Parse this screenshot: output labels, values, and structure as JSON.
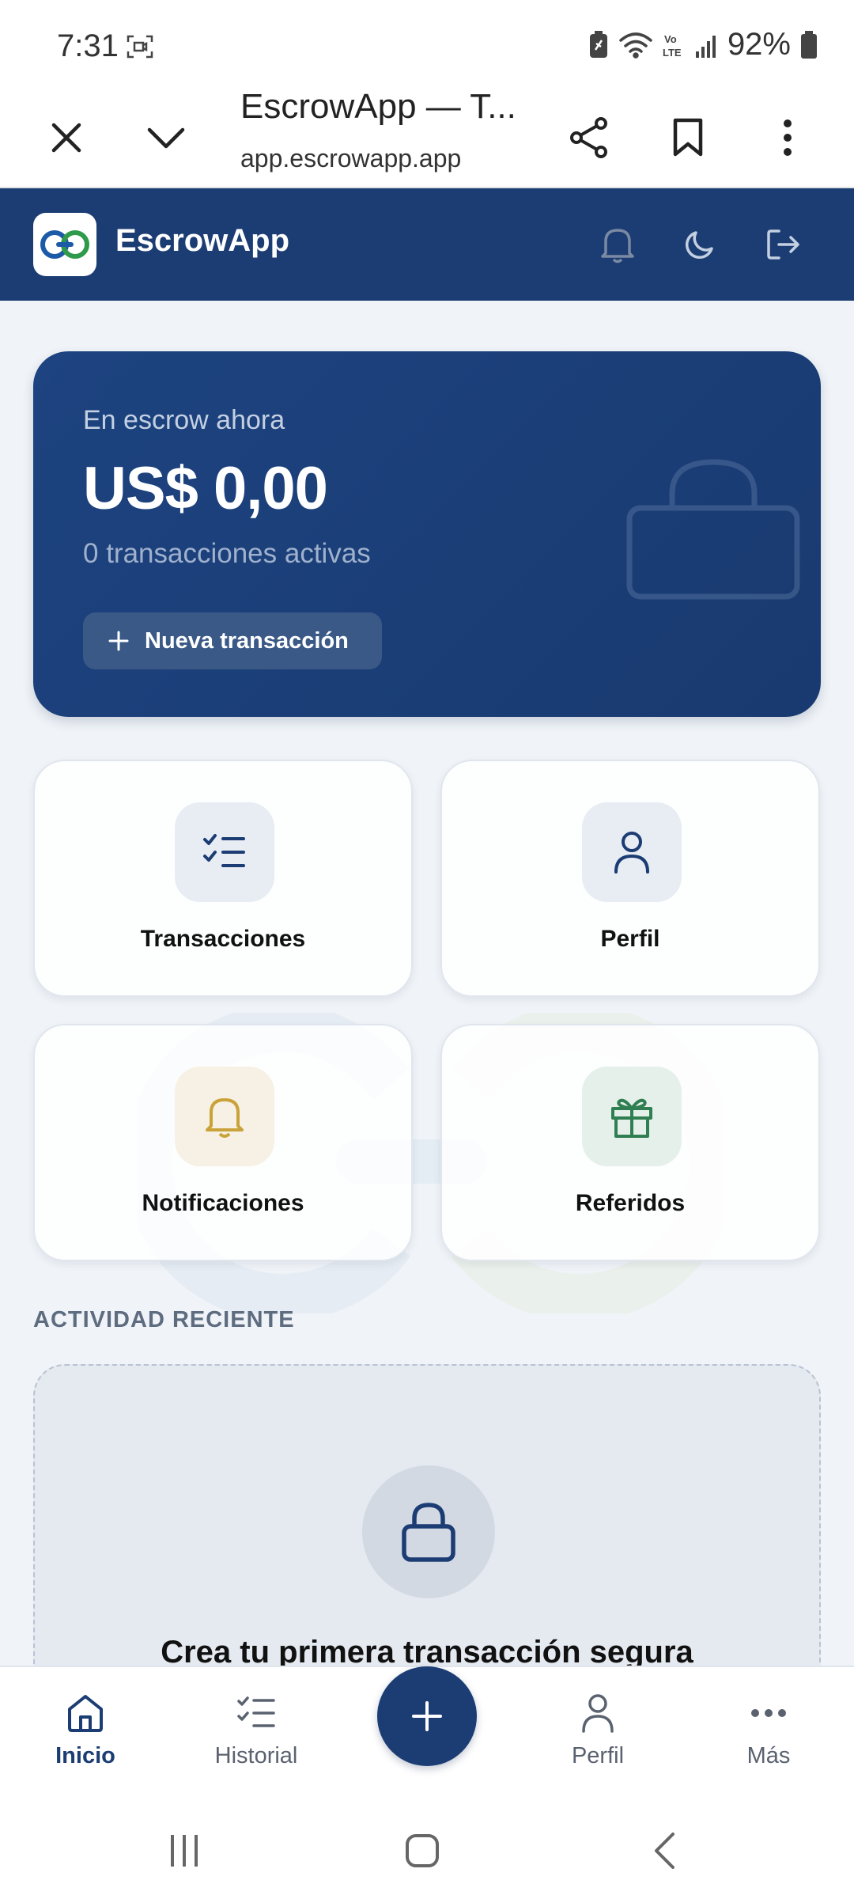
{
  "status_bar": {
    "time": "7:31",
    "battery": "92%"
  },
  "browser": {
    "title": "EscrowApp — T...",
    "url": "app.escrowapp.app"
  },
  "header": {
    "app_name": "EscrowApp",
    "brand_color": "#1c3d73"
  },
  "balance": {
    "label": "En escrow ahora",
    "amount": "US$ 0,00",
    "active": "0 transacciones activas",
    "new_button": "Nueva transacción"
  },
  "tiles": [
    {
      "label": "Transacciones",
      "icon": "list-check-icon"
    },
    {
      "label": "Perfil",
      "icon": "user-icon"
    },
    {
      "label": "Notificaciones",
      "icon": "bell-icon"
    },
    {
      "label": "Referidos",
      "icon": "gift-icon"
    }
  ],
  "recent": {
    "section_title": "ACTIVIDAD RECIENTE",
    "empty_title": "Crea tu primera transacción segura"
  },
  "bottom_nav": {
    "items": [
      {
        "label": "Inicio",
        "icon": "home-icon",
        "active": true
      },
      {
        "label": "Historial",
        "icon": "list-check-icon"
      },
      {
        "label": "Perfil",
        "icon": "user-icon"
      },
      {
        "label": "Más",
        "icon": "more-horizontal-icon"
      }
    ],
    "fab_icon": "plus-icon"
  }
}
